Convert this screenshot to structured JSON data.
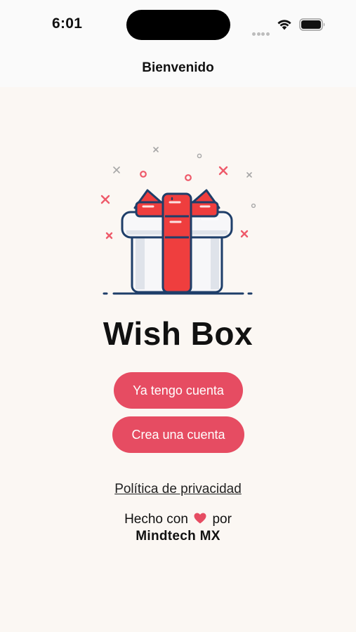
{
  "status_bar": {
    "time": "6:01"
  },
  "nav": {
    "title": "Bienvenido"
  },
  "app": {
    "title": "Wish Box"
  },
  "buttons": {
    "login_label": "Ya tengo cuenta",
    "signup_label": "Crea una cuenta"
  },
  "links": {
    "privacy_label": "Política de privacidad"
  },
  "credits": {
    "prefix": "Hecho con",
    "suffix": "por",
    "company": "Mindtech MX"
  },
  "colors": {
    "background": "#fbf7f3",
    "accent": "#e64c62",
    "ribbon": "#ef3e3e",
    "outline": "#1e3e69"
  },
  "icons": {
    "illustration": "gift-box-icon",
    "heart": "heart-icon",
    "wifi": "wifi-icon",
    "battery": "battery-icon",
    "signal": "signal-icon"
  }
}
